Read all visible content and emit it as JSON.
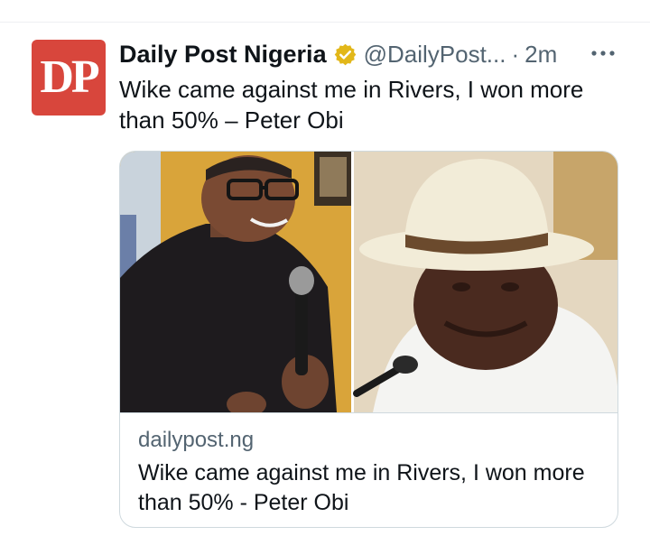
{
  "tweet": {
    "avatar_initials": "DP",
    "display_name": "Daily Post Nigeria",
    "handle": "@DailyPost...",
    "separator": "·",
    "time": "2m",
    "text": "Wike came against me in Rivers, I won more than 50% – Peter Obi"
  },
  "card": {
    "domain": "dailypost.ng",
    "title": "Wike came against me in Rivers, I won more than 50% - Peter Obi"
  },
  "colors": {
    "avatar_bg": "#d8463c",
    "verified_badge": "#e2b719",
    "text_primary": "#0f1419",
    "text_secondary": "#536471",
    "border": "#cfd9de"
  },
  "icons": {
    "verified": "verified-badge-icon",
    "more": "more-options-icon"
  }
}
